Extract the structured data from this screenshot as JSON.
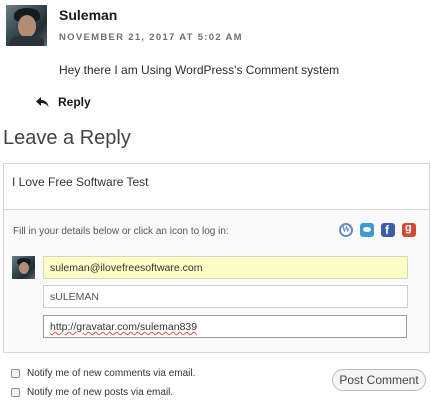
{
  "comment": {
    "author": "Suleman",
    "date": "NOVEMBER 21, 2017 AT 5:02 AM",
    "text": "Hey there I am Using WordPress's Comment system",
    "reply_label": "Reply"
  },
  "reply_form": {
    "heading": "Leave a Reply",
    "comment_value": "I Love Free Software Test",
    "login_prompt": "Fill in your details below or click an icon to log in:",
    "login_icons": [
      "wordpress-icon",
      "twitter-icon",
      "facebook-icon",
      "google-plus-icon"
    ],
    "email_value": "suleman@ilovefreesoftware.com",
    "name_value": "sULEMAN",
    "url_prefix": "http://",
    "url_rest": "gravatar.com/suleman839",
    "notify_comments_label": "Notify me of new comments via email.",
    "notify_posts_label": "Notify me of new posts via email.",
    "submit_label": "Post Comment"
  },
  "colors": {
    "email_autofill_bg": "#fdfdc6",
    "twitter": "#3d9ad5",
    "facebook": "#3b5ea8",
    "google_plus": "#d04b36",
    "wordpress": "#6a8ec2"
  }
}
